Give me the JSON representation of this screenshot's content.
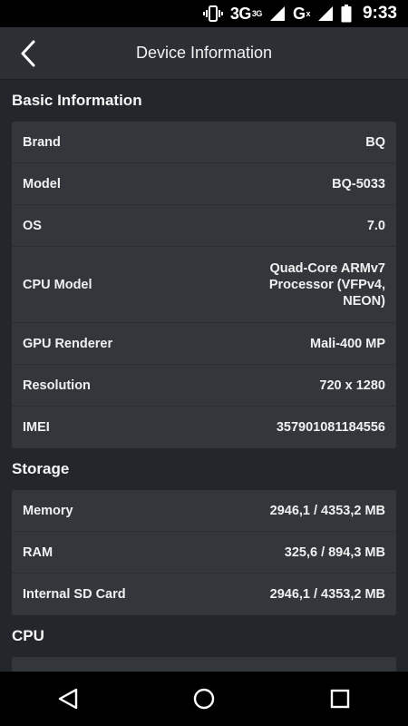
{
  "status_bar": {
    "network_1": "3G",
    "network_1_sup": "3G",
    "network_2": "G",
    "network_2_sup": "x",
    "time": "9:33"
  },
  "app_bar": {
    "title": "Device Information",
    "back_icon": "chevron-left-icon"
  },
  "sections": {
    "basic": {
      "title": "Basic Information",
      "rows": [
        {
          "label": "Brand",
          "value": "BQ"
        },
        {
          "label": "Model",
          "value": "BQ-5033"
        },
        {
          "label": "OS",
          "value": "7.0"
        },
        {
          "label": "CPU Model",
          "value": "Quad-Core ARMv7\nProcessor (VFPv4,\nNEON)"
        },
        {
          "label": "GPU Renderer",
          "value": "Mali-400 MP"
        },
        {
          "label": "Resolution",
          "value": "720 x 1280"
        },
        {
          "label": "IMEI",
          "value": "357901081184556"
        }
      ]
    },
    "storage": {
      "title": "Storage",
      "rows": [
        {
          "label": "Memory",
          "value": "2946,1 / 4353,2 MB"
        },
        {
          "label": "RAM",
          "value": "325,6 / 894,3 MB"
        },
        {
          "label": "Internal SD Card",
          "value": "2946,1 / 4353,2 MB"
        }
      ]
    },
    "cpu": {
      "title": "CPU"
    }
  },
  "nav_bar": {
    "back": "back-triangle-icon",
    "home": "home-circle-icon",
    "recents": "recents-square-icon"
  },
  "colors": {
    "background": "#23272c",
    "card": "#33373c",
    "app_bar": "#2c3035",
    "system_bars": "#000000"
  }
}
